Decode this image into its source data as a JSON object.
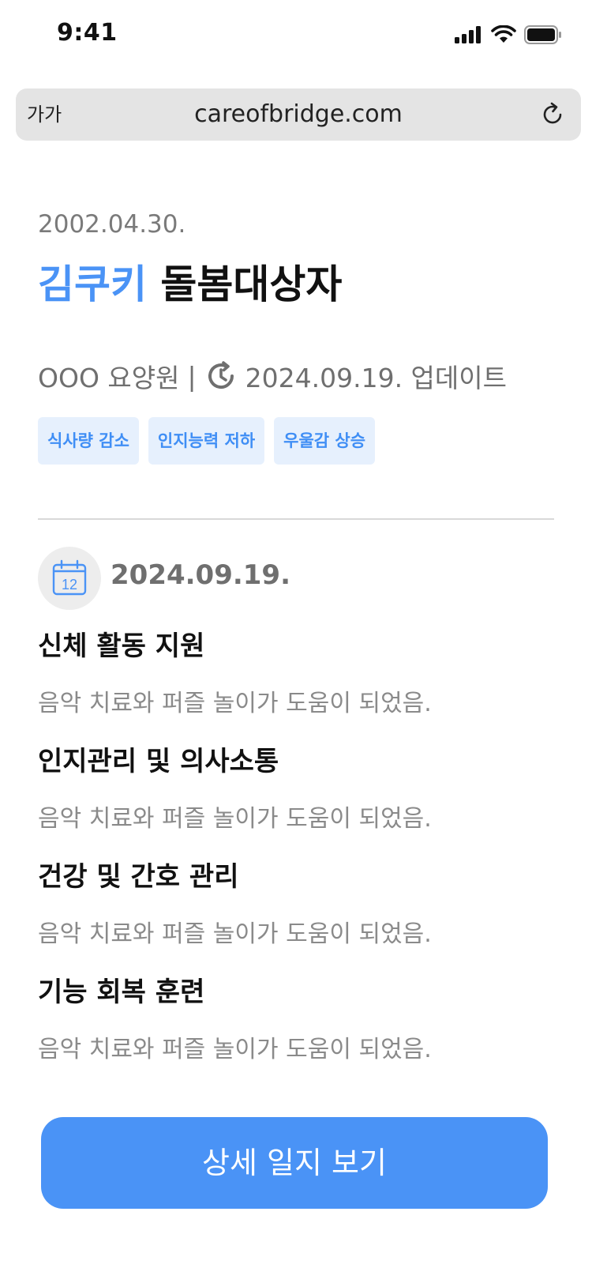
{
  "status_bar": {
    "time": "9:41",
    "icons": [
      "signal-icon",
      "wifi-icon",
      "battery-icon"
    ]
  },
  "browser": {
    "text_size_label": "가가",
    "url": "careofbridge.com",
    "reload_icon": "reload-icon"
  },
  "profile": {
    "birth_date": "2002.04.30.",
    "name": "김쿠키",
    "role": "돌봄대상자",
    "facility": "OOO 요양원",
    "separator": "|",
    "update_icon": "clock-history-icon",
    "updated": "2024.09.19. 업데이트",
    "tags": [
      "식사량 감소",
      "인지능력 저하",
      "우울감 상승"
    ]
  },
  "journal": {
    "calendar_icon": "calendar-icon",
    "calendar_day": "12",
    "date": "2024.09.19.",
    "sections": [
      {
        "title": "신체 활동 지원",
        "body": "음악 치료와 퍼즐 놀이가 도움이 되었음."
      },
      {
        "title": "인지관리 및 의사소통",
        "body": "음악 치료와 퍼즐 놀이가 도움이 되었음."
      },
      {
        "title": "건강 및 간호 관리",
        "body": "음악 치료와 퍼즐 놀이가 도움이 되었음."
      },
      {
        "title": "기능 회복 훈련",
        "body": "음악 치료와 퍼즐 놀이가 도움이 되었음."
      }
    ]
  },
  "cta": {
    "label": "상세 일지 보기"
  },
  "colors": {
    "accent": "#4a93f6",
    "tag_bg": "#e6f0fd",
    "muted_text": "#7a7a7a",
    "divider": "#d8d8d8"
  }
}
